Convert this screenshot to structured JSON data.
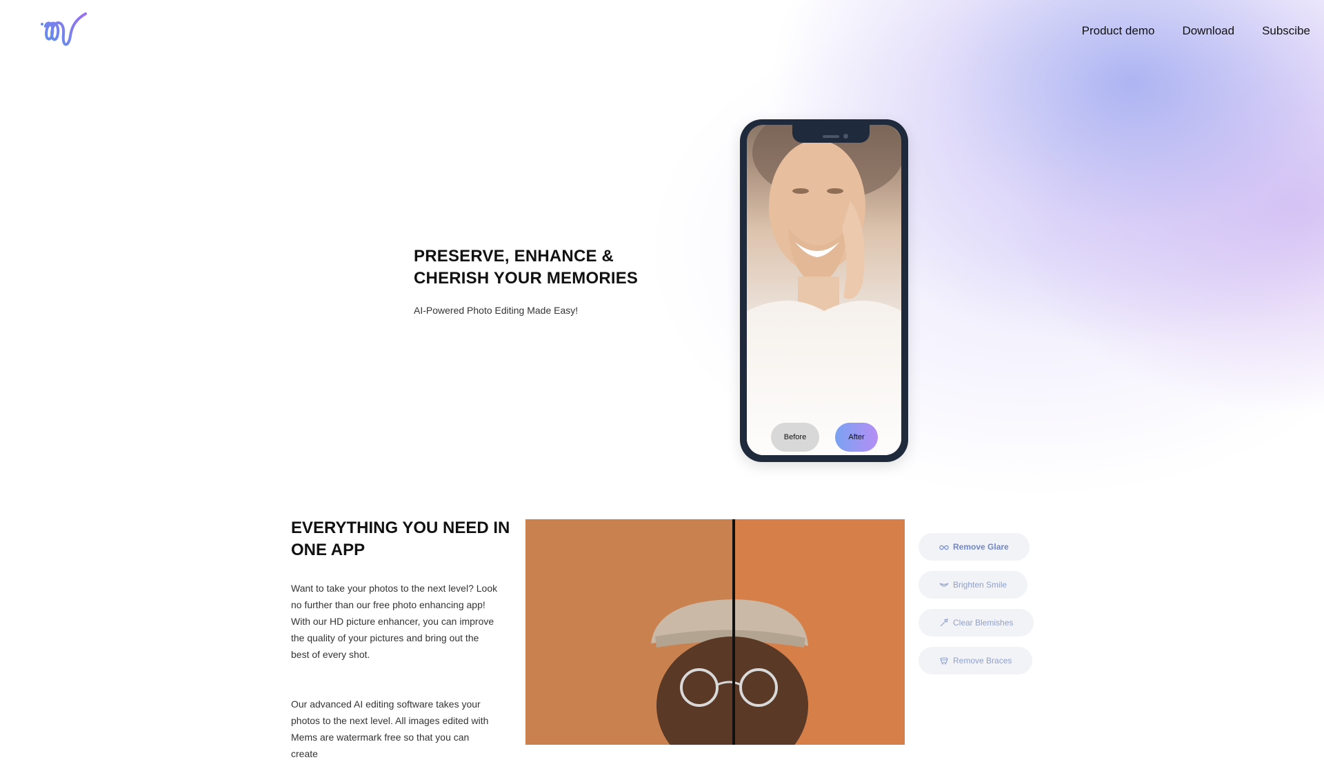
{
  "nav": {
    "items": [
      {
        "label": "Product demo"
      },
      {
        "label": "Download"
      },
      {
        "label": "Subscibe"
      }
    ]
  },
  "hero": {
    "title": "PRESERVE, ENHANCE & CHERISH YOUR MEMORIES",
    "subtitle": "AI-Powered Photo Editing Made Easy!",
    "phone": {
      "before_label": "Before",
      "after_label": "After"
    }
  },
  "features_section": {
    "title": "EVERYTHING YOU NEED IN ONE APP",
    "paragraph1": "Want to take your photos to the next level? Look no further than our free photo enhancing app! With our HD picture enhancer, you can improve the quality of your pictures and bring out the best of every shot.",
    "paragraph2": "Our advanced AI editing software takes your photos to the next level. All images edited with Mems are watermark free so that you can create",
    "features": [
      {
        "label": "Remove Glare",
        "icon": "glasses-icon"
      },
      {
        "label": "Brighten Smile",
        "icon": "smile-icon"
      },
      {
        "label": "Clear Blemishes",
        "icon": "brush-icon"
      },
      {
        "label": "Remove Braces",
        "icon": "tooth-icon"
      }
    ]
  },
  "colors": {
    "accent_blue": "#7aa2f0",
    "accent_purple": "#b58ef5",
    "feature_text": "#8ea0cf"
  }
}
